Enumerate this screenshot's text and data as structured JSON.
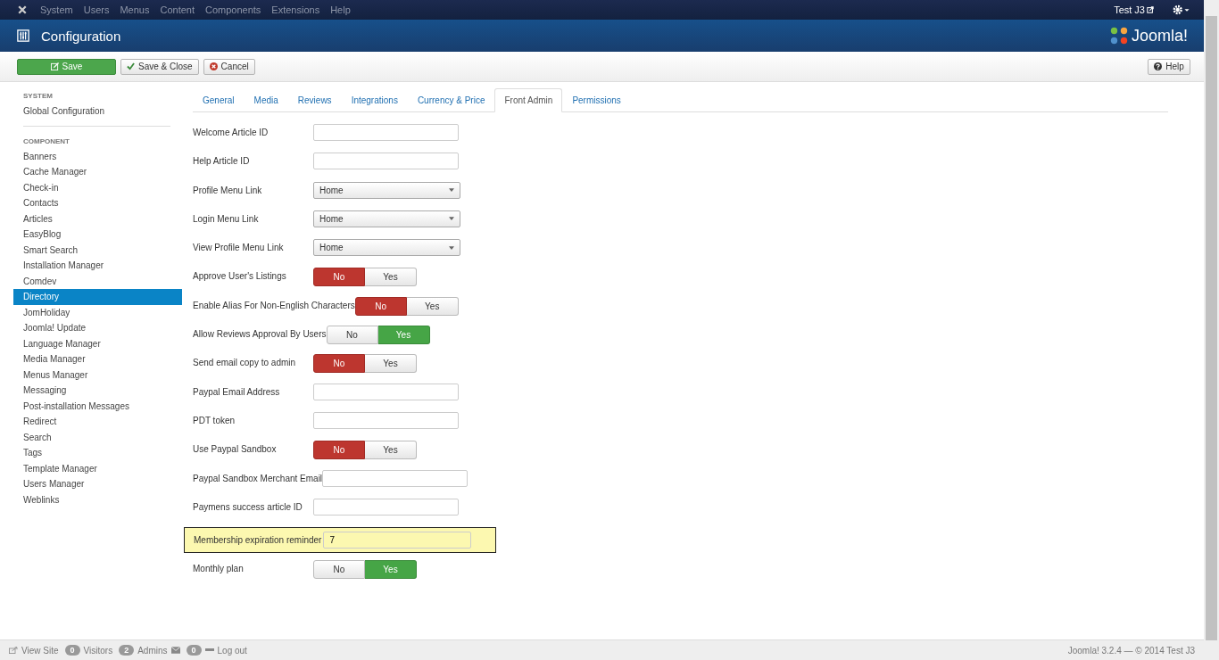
{
  "top_menu": {
    "items": [
      "System",
      "Users",
      "Menus",
      "Content",
      "Components",
      "Extensions",
      "Help"
    ],
    "user": "Test J3"
  },
  "header": {
    "title": "Configuration",
    "brand": "Joomla!"
  },
  "toolbar": {
    "buttons": [
      {
        "label": "Save",
        "kind": "primary"
      },
      {
        "label": "Save & Close",
        "kind": "check"
      },
      {
        "label": "Cancel",
        "kind": "cancel"
      }
    ],
    "help": "Help"
  },
  "sidebar": {
    "sections": [
      {
        "heading": "SYSTEM",
        "items": [
          {
            "label": "Global Configuration",
            "selected": false
          }
        ]
      },
      {
        "heading": "COMPONENT",
        "items": [
          {
            "label": "Banners",
            "selected": false
          },
          {
            "label": "Cache Manager",
            "selected": false
          },
          {
            "label": "Check-in",
            "selected": false
          },
          {
            "label": "Contacts",
            "selected": false
          },
          {
            "label": "Articles",
            "selected": false
          },
          {
            "label": "EasyBlog",
            "selected": false
          },
          {
            "label": "Smart Search",
            "selected": false
          },
          {
            "label": "Installation Manager",
            "selected": false
          },
          {
            "label": "Comdev",
            "selected": false
          },
          {
            "label": "Directory",
            "selected": true
          },
          {
            "label": "JomHoliday",
            "selected": false
          },
          {
            "label": "Joomla! Update",
            "selected": false
          },
          {
            "label": "Language Manager",
            "selected": false
          },
          {
            "label": "Media Manager",
            "selected": false
          },
          {
            "label": "Menus Manager",
            "selected": false
          },
          {
            "label": "Messaging",
            "selected": false
          },
          {
            "label": "Post-installation Messages",
            "selected": false
          },
          {
            "label": "Redirect",
            "selected": false
          },
          {
            "label": "Search",
            "selected": false
          },
          {
            "label": "Tags",
            "selected": false
          },
          {
            "label": "Template Manager",
            "selected": false
          },
          {
            "label": "Users Manager",
            "selected": false
          },
          {
            "label": "Weblinks",
            "selected": false
          }
        ]
      }
    ]
  },
  "tabs": [
    {
      "label": "General",
      "selected": false
    },
    {
      "label": "Media",
      "selected": false
    },
    {
      "label": "Reviews",
      "selected": false
    },
    {
      "label": "Integrations",
      "selected": false
    },
    {
      "label": "Currency & Price",
      "selected": false
    },
    {
      "label": "Front Admin",
      "selected": true
    },
    {
      "label": "Permissions",
      "selected": false
    }
  ],
  "fields": [
    {
      "label": "Welcome Article ID",
      "kind": "text",
      "highlighted": false
    },
    {
      "label": "Help Article ID",
      "kind": "text",
      "highlighted": false
    },
    {
      "label": "Profile Menu Link",
      "kind": "select",
      "value": "Home",
      "highlighted": false
    },
    {
      "label": "Login Menu Link",
      "kind": "select",
      "value": "Home",
      "highlighted": false
    },
    {
      "label": "View Profile Menu Link",
      "kind": "select",
      "value": "Home",
      "highlighted": false
    },
    {
      "label": "Approve User's Listings",
      "kind": "toggle",
      "highlighted": false,
      "options": [
        {
          "label": "No",
          "selected": true
        },
        {
          "label": "Yes",
          "selected": false
        }
      ]
    },
    {
      "label": "Enable Alias For Non-English Characters",
      "kind": "toggle",
      "highlighted": false,
      "options": [
        {
          "label": "No",
          "selected": true
        },
        {
          "label": "Yes",
          "selected": false
        }
      ]
    },
    {
      "label": "Allow Reviews Approval By Users",
      "kind": "toggle",
      "highlighted": false,
      "options": [
        {
          "label": "No",
          "selected": false
        },
        {
          "label": "Yes",
          "selected": true
        }
      ]
    },
    {
      "label": "Send email copy to admin",
      "kind": "toggle",
      "highlighted": false,
      "options": [
        {
          "label": "No",
          "selected": true
        },
        {
          "label": "Yes",
          "selected": false
        }
      ]
    },
    {
      "label": "Paypal Email Address",
      "kind": "text",
      "highlighted": false
    },
    {
      "label": "PDT token",
      "kind": "text",
      "highlighted": false
    },
    {
      "label": "Use Paypal Sandbox",
      "kind": "toggle",
      "highlighted": false,
      "options": [
        {
          "label": "No",
          "selected": true
        },
        {
          "label": "Yes",
          "selected": false
        }
      ]
    },
    {
      "label": "Paypal Sandbox Merchant Email",
      "kind": "text",
      "highlighted": false
    },
    {
      "label": "Paymens success article ID",
      "kind": "text",
      "highlighted": false
    },
    {
      "label": "Membership expiration reminder",
      "kind": "text",
      "value": "7",
      "highlighted": true
    },
    {
      "label": "Monthly plan",
      "kind": "toggle",
      "highlighted": false,
      "options": [
        {
          "label": "No",
          "selected": false
        },
        {
          "label": "Yes",
          "selected": true
        }
      ]
    }
  ],
  "status_bar": {
    "view_site": "View Site",
    "visitors_count": "0",
    "visitors": "Visitors",
    "admins_count": "2",
    "admins": "Admins",
    "messages_count": "0",
    "logout": "Log out",
    "version": "Joomla! 3.2.4 — © 2014 Test J3"
  }
}
